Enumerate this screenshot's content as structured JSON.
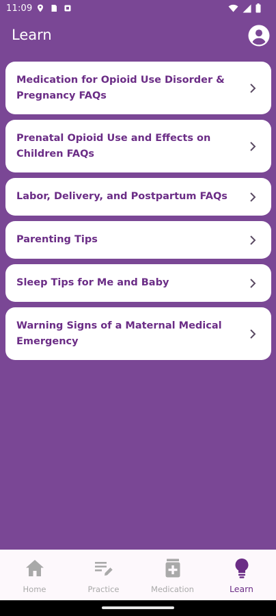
{
  "status_bar": {
    "time": "11:09"
  },
  "header": {
    "title": "Learn"
  },
  "cards": [
    {
      "label": "Medication for Opioid Use Disorder & Pregnancy FAQs"
    },
    {
      "label": "Prenatal Opioid Use and Effects on Children FAQs"
    },
    {
      "label": "Labor, Delivery, and Postpartum FAQs"
    },
    {
      "label": "Parenting Tips"
    },
    {
      "label": "Sleep Tips for Me and Baby"
    },
    {
      "label": "Warning Signs of a Maternal Medical Emergency"
    }
  ],
  "bottom_nav": {
    "items": [
      {
        "label": "Home",
        "icon": "home-icon",
        "active": false
      },
      {
        "label": "Practice",
        "icon": "practice-icon",
        "active": false
      },
      {
        "label": "Medication",
        "icon": "medication-icon",
        "active": false
      },
      {
        "label": "Learn",
        "icon": "lightbulb-icon",
        "active": true
      }
    ]
  },
  "colors": {
    "background": "#7a4795",
    "card": "#ffffff",
    "card_text": "#6b2d86",
    "nav_background": "#fdf8fc",
    "nav_inactive": "#a9a9a9",
    "nav_active": "#6b2d86"
  }
}
